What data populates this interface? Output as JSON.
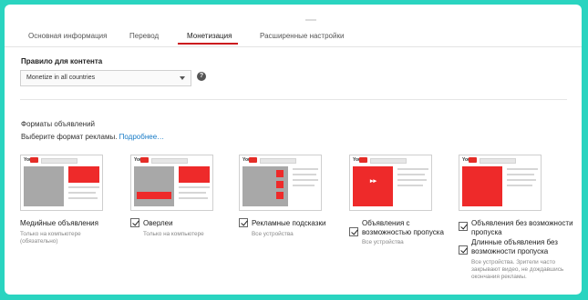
{
  "tabs": [
    {
      "label": "Основная информация"
    },
    {
      "label": "Перевод"
    },
    {
      "label": "Монетизация"
    },
    {
      "label": "Расширенные настройки"
    }
  ],
  "content_rule": {
    "title": "Правило для контента",
    "selected": "Monetize in all countries",
    "help": "?"
  },
  "formats": {
    "title": "Форматы объявлений",
    "subtitle": "Выберите формат рекламы.",
    "more_link": "Подробнее…",
    "items": [
      {
        "label": "Медийные объявления",
        "note": "Только на компьютере (обязательно)"
      },
      {
        "label": "Оверлеи",
        "note": "Только на компьютере"
      },
      {
        "label": "Рекламные подсказки",
        "note": "Все устройства"
      },
      {
        "label": "Объявления с возможностью пропуска",
        "note": "Все устройства"
      },
      {
        "label": "Объявления без возможности пропуска",
        "label2": "Длинные объявления без возможности пропуска",
        "note": "Все устройства. Зрители часто закрывают видео, не дождавшись окончания рекламы."
      }
    ],
    "logo_text": "You"
  }
}
